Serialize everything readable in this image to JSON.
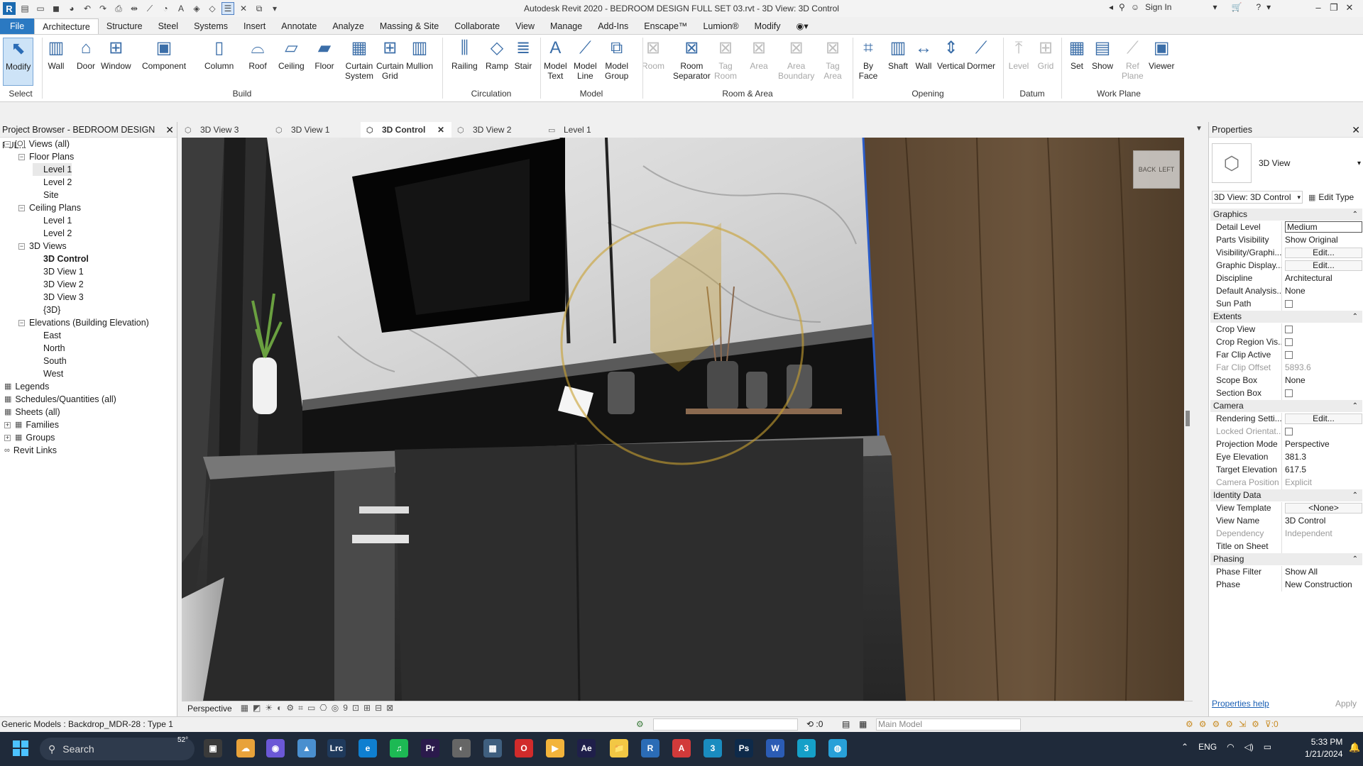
{
  "app": {
    "title": "Autodesk Revit 2020 - BEDROOM DESIGN FULL SET 03.rvt - 3D View: 3D Control",
    "sign_in": "Sign In",
    "logo": "R"
  },
  "ribbon_tabs": [
    "File",
    "Architecture",
    "Structure",
    "Steel",
    "Systems",
    "Insert",
    "Annotate",
    "Analyze",
    "Massing & Site",
    "Collaborate",
    "View",
    "Manage",
    "Add-Ins",
    "Enscape™",
    "Lumion®",
    "Modify"
  ],
  "ribbon": {
    "buttons": [
      {
        "label": "Modify",
        "icon": "cursor-icon",
        "selected": true
      },
      {
        "label": "Wall",
        "icon": "wall-icon"
      },
      {
        "label": "Door",
        "icon": "door-icon"
      },
      {
        "label": "Window",
        "icon": "window-icon"
      },
      {
        "label": "Component",
        "icon": "component-icon"
      },
      {
        "label": "Column",
        "icon": "column-icon"
      },
      {
        "label": "Roof",
        "icon": "roof-icon"
      },
      {
        "label": "Ceiling",
        "icon": "ceiling-icon"
      },
      {
        "label": "Floor",
        "icon": "floor-icon"
      },
      {
        "label": "Curtain\nSystem",
        "icon": "curtain-system-icon"
      },
      {
        "label": "Curtain\nGrid",
        "icon": "curtain-grid-icon"
      },
      {
        "label": "Mullion",
        "icon": "mullion-icon"
      },
      {
        "label": "Railing",
        "icon": "railing-icon"
      },
      {
        "label": "Ramp",
        "icon": "ramp-icon"
      },
      {
        "label": "Stair",
        "icon": "stair-icon"
      },
      {
        "label": "Model\nText",
        "icon": "model-text-icon"
      },
      {
        "label": "Model\nLine",
        "icon": "model-line-icon"
      },
      {
        "label": "Model\nGroup",
        "icon": "model-group-icon"
      },
      {
        "label": "Room",
        "icon": "room-icon",
        "disabled": true
      },
      {
        "label": "Room\nSeparator",
        "icon": "room-separator-icon"
      },
      {
        "label": "Tag\nRoom",
        "icon": "tag-room-icon",
        "disabled": true
      },
      {
        "label": "Area",
        "icon": "area-icon",
        "disabled": true
      },
      {
        "label": "Area\nBoundary",
        "icon": "area-boundary-icon",
        "disabled": true
      },
      {
        "label": "Tag\nArea",
        "icon": "tag-area-icon",
        "disabled": true
      },
      {
        "label": "By\nFace",
        "icon": "by-face-icon"
      },
      {
        "label": "Shaft",
        "icon": "shaft-icon"
      },
      {
        "label": "Wall",
        "icon": "wall-opening-icon"
      },
      {
        "label": "Vertical",
        "icon": "vertical-icon"
      },
      {
        "label": "Dormer",
        "icon": "dormer-icon"
      },
      {
        "label": "Level",
        "icon": "level-icon",
        "disabled": true
      },
      {
        "label": "Grid",
        "icon": "grid-icon",
        "disabled": true
      },
      {
        "label": "Set",
        "icon": "set-icon"
      },
      {
        "label": "Show",
        "icon": "show-icon"
      },
      {
        "label": "Ref\nPlane",
        "icon": "ref-plane-icon",
        "disabled": true
      },
      {
        "label": "Viewer",
        "icon": "viewer-icon"
      }
    ],
    "panels": [
      "Select",
      "Build",
      "Circulation",
      "Model",
      "Room & Area",
      "Opening",
      "Datum",
      "Work Plane"
    ]
  },
  "project_browser": {
    "title": "Project Browser - BEDROOM DESIGN FUL...",
    "items": [
      {
        "label": "Views (all)",
        "level": 0,
        "toggle": "−",
        "icon": "[O]"
      },
      {
        "label": "Floor Plans",
        "level": 1,
        "toggle": "−"
      },
      {
        "label": "Level 1",
        "level": 2,
        "selected": true
      },
      {
        "label": "Level 2",
        "level": 2
      },
      {
        "label": "Site",
        "level": 2
      },
      {
        "label": "Ceiling Plans",
        "level": 1,
        "toggle": "−"
      },
      {
        "label": "Level 1",
        "level": 2
      },
      {
        "label": "Level 2",
        "level": 2
      },
      {
        "label": "3D Views",
        "level": 1,
        "toggle": "−"
      },
      {
        "label": "3D Control",
        "level": 2,
        "bold": true
      },
      {
        "label": "3D View 1",
        "level": 2
      },
      {
        "label": "3D View 2",
        "level": 2
      },
      {
        "label": "3D View 3",
        "level": 2
      },
      {
        "label": "{3D}",
        "level": 2
      },
      {
        "label": "Elevations (Building Elevation)",
        "level": 1,
        "toggle": "−"
      },
      {
        "label": "East",
        "level": 2
      },
      {
        "label": "North",
        "level": 2
      },
      {
        "label": "South",
        "level": 2
      },
      {
        "label": "West",
        "level": 2
      },
      {
        "label": "Legends",
        "level": 0,
        "icon": "▦"
      },
      {
        "label": "Schedules/Quantities (all)",
        "level": 0,
        "icon": "▦"
      },
      {
        "label": "Sheets (all)",
        "level": 0,
        "icon": "▦"
      },
      {
        "label": "Families",
        "level": 0,
        "toggle": "+",
        "icon": "▦"
      },
      {
        "label": "Groups",
        "level": 0,
        "toggle": "+",
        "icon": "▦"
      },
      {
        "label": "Revit Links",
        "level": 0,
        "icon": "∞"
      }
    ]
  },
  "view_tabs": [
    {
      "label": "3D View 3"
    },
    {
      "label": "3D View 1"
    },
    {
      "label": "3D Control",
      "active": true
    },
    {
      "label": "3D View 2"
    },
    {
      "label": "Level 1"
    }
  ],
  "viewport": {
    "view_cube_labels": [
      "BACK",
      "LEFT"
    ],
    "scale_label": "Perspective",
    "scale_num": "9"
  },
  "properties": {
    "title": "Properties",
    "type_name": "3D View",
    "selector": "3D View: 3D Control",
    "edit_type": "Edit Type",
    "groups": [
      {
        "name": "Graphics",
        "rows": [
          {
            "k": "Detail Level",
            "v": "Medium",
            "boxed": true
          },
          {
            "k": "Parts Visibility",
            "v": "Show Original"
          },
          {
            "k": "Visibility/Graphi...",
            "v": "Edit...",
            "button": true
          },
          {
            "k": "Graphic Display...",
            "v": "Edit...",
            "button": true
          },
          {
            "k": "Discipline",
            "v": "Architectural"
          },
          {
            "k": "Default Analysis...",
            "v": "None"
          },
          {
            "k": "Sun Path",
            "checkbox": true
          }
        ]
      },
      {
        "name": "Extents",
        "rows": [
          {
            "k": "Crop View",
            "checkbox": true
          },
          {
            "k": "Crop Region Vis...",
            "checkbox": true
          },
          {
            "k": "Far Clip Active",
            "checkbox": true
          },
          {
            "k": "Far Clip Offset",
            "v": "5893.6",
            "dim": true
          },
          {
            "k": "Scope Box",
            "v": "None"
          },
          {
            "k": "Section Box",
            "checkbox": true
          }
        ]
      },
      {
        "name": "Camera",
        "rows": [
          {
            "k": "Rendering Setti...",
            "v": "Edit...",
            "button": true
          },
          {
            "k": "Locked Orientat...",
            "checkbox": true,
            "dim": true
          },
          {
            "k": "Projection Mode",
            "v": "Perspective"
          },
          {
            "k": "Eye Elevation",
            "v": "381.3"
          },
          {
            "k": "Target Elevation",
            "v": "617.5"
          },
          {
            "k": "Camera Position",
            "v": "Explicit",
            "dim": true
          }
        ]
      },
      {
        "name": "Identity Data",
        "rows": [
          {
            "k": "View Template",
            "v": "<None>",
            "button": true
          },
          {
            "k": "View Name",
            "v": "3D Control"
          },
          {
            "k": "Dependency",
            "v": "Independent",
            "dim": true
          },
          {
            "k": "Title on Sheet",
            "v": ""
          }
        ]
      },
      {
        "name": "Phasing",
        "rows": [
          {
            "k": "Phase Filter",
            "v": "Show All"
          },
          {
            "k": "Phase",
            "v": "New Construction"
          }
        ]
      }
    ],
    "help_link": "Properties help",
    "apply": "Apply"
  },
  "status_bar": {
    "selection": "Generic Models : Backdrop_MDR-28 : Type 1",
    "coord": ":0",
    "model": "Main Model",
    "filter": ":0"
  },
  "taskbar": {
    "search_placeholder": "Search",
    "temperature": "52°",
    "language": "ENG",
    "time": "5:33 PM",
    "date": "1/21/2024",
    "apps": [
      {
        "label": "▣",
        "color": "#3a3a3a"
      },
      {
        "label": "☁",
        "color": "#e8a23a"
      },
      {
        "label": "◉",
        "color": "#6b58d6"
      },
      {
        "label": "▲",
        "color": "#4a8fcf"
      },
      {
        "label": "Lrc",
        "color": "#1f3a5c"
      },
      {
        "label": "e",
        "color": "#0f7fd0"
      },
      {
        "label": "♫",
        "color": "#1db954"
      },
      {
        "label": "Pr",
        "color": "#2b1a4c"
      },
      {
        "label": "◐",
        "color": "#666"
      },
      {
        "label": "▦",
        "color": "#3f5f7f"
      },
      {
        "label": "O",
        "color": "#d12b2b"
      },
      {
        "label": "▶",
        "color": "#f3b43b"
      },
      {
        "label": "Ae",
        "color": "#1f1f4a"
      },
      {
        "label": "📁",
        "color": "#f2c744"
      },
      {
        "label": "R",
        "color": "#2b6cb6"
      },
      {
        "label": "A",
        "color": "#d23a3a"
      },
      {
        "label": "3",
        "color": "#1a8cbf"
      },
      {
        "label": "Ps",
        "color": "#0e2a4a"
      },
      {
        "label": "W",
        "color": "#2b5cb5"
      },
      {
        "label": "3",
        "color": "#15a0c8"
      },
      {
        "label": "◍",
        "color": "#28a0d8"
      }
    ]
  }
}
